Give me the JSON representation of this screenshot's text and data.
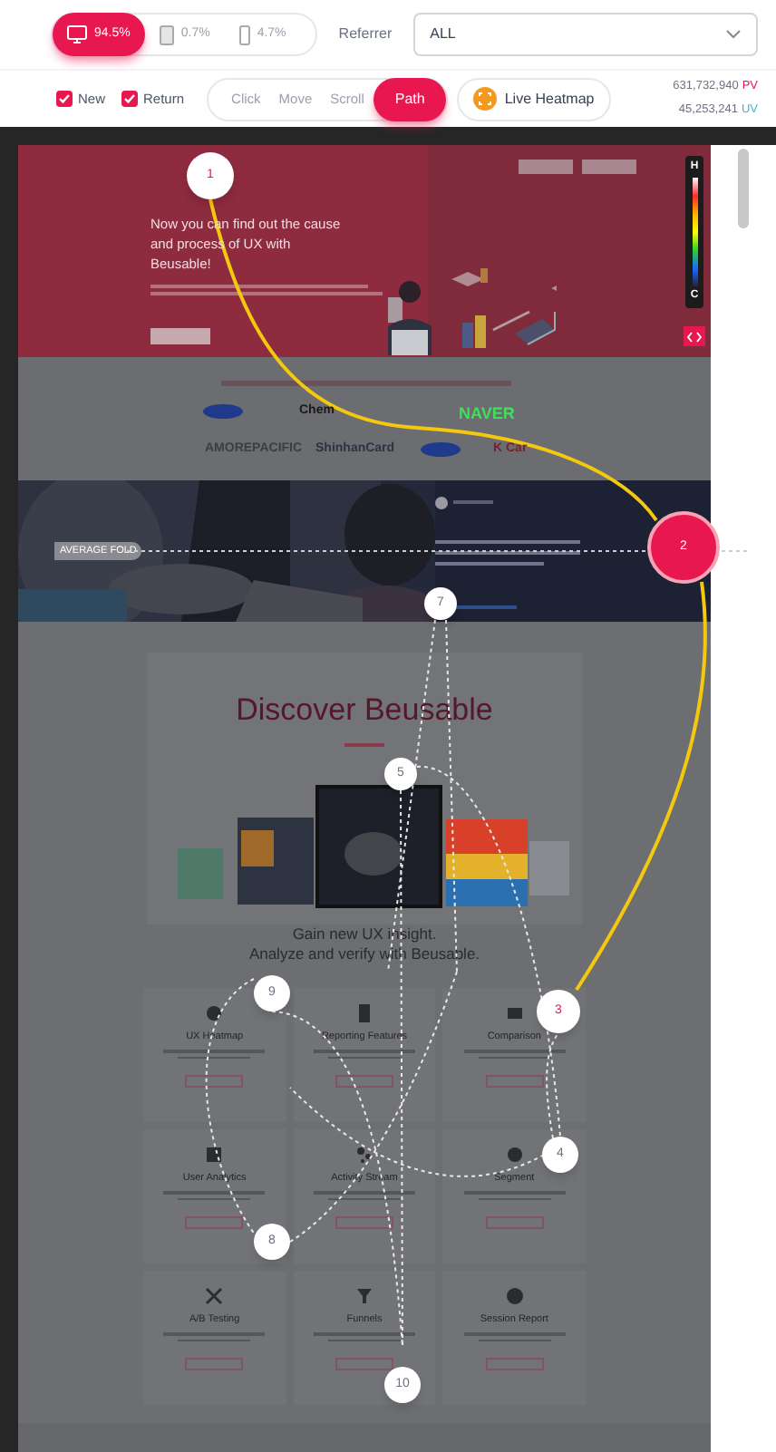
{
  "device_tabs": [
    {
      "label": "94.5%",
      "kind": "desktop",
      "selected": true
    },
    {
      "label": "0.7%",
      "kind": "tablet",
      "selected": false
    },
    {
      "label": "4.7%",
      "kind": "mobile",
      "selected": false
    }
  ],
  "referrer": {
    "label": "Referrer",
    "value": "ALL"
  },
  "filters": [
    {
      "label": "New",
      "checked": true
    },
    {
      "label": "Return",
      "checked": true
    }
  ],
  "modes": [
    {
      "label": "Click",
      "selected": false
    },
    {
      "label": "Move",
      "selected": false
    },
    {
      "label": "Scroll",
      "selected": false
    },
    {
      "label": "Path",
      "selected": true
    }
  ],
  "live_button": {
    "label": "Live Heatmap"
  },
  "stats": [
    {
      "value": "631,732,940",
      "unit": "PV",
      "color": "#e8174f"
    },
    {
      "value": "45,253,241",
      "unit": "UV",
      "color": "#3fb6c4"
    }
  ],
  "site": {
    "hero_title": "Now you can find out the cause and process of UX with Beusable!",
    "logos": [
      {
        "label": "Chem",
        "color": "#1a1a1a"
      },
      {
        "label": "NAVER",
        "color": "#3ee05a"
      },
      {
        "label": "AMOREPACIFIC",
        "color": "#3c3d42"
      },
      {
        "label": "ShinhanCard",
        "color": "#2f3240"
      },
      {
        "label": "K Car",
        "color": "#7a1f2a"
      }
    ],
    "discover_title": "Discover Beusable",
    "tagline": [
      "Gain new UX insight.",
      "Analyze and verify with Beusable."
    ],
    "cards": [
      {
        "title": "UX Heatmap"
      },
      {
        "title": "Reporting Features"
      },
      {
        "title": "Comparison"
      },
      {
        "title": "User Analytics"
      },
      {
        "title": "Activity Stream"
      },
      {
        "title": "Segment"
      },
      {
        "title": "A/B Testing"
      },
      {
        "title": "Funnels"
      },
      {
        "title": "Session Report"
      }
    ]
  },
  "heat_scale": {
    "top": "H",
    "bottom": "C"
  },
  "fold_label": "AVERAGE FOLD",
  "path_markers": [
    {
      "label": "1",
      "kind": "primary"
    },
    {
      "label": "2",
      "kind": "highlight"
    },
    {
      "label": "3",
      "kind": "primary"
    },
    {
      "label": "4",
      "kind": "secondary"
    },
    {
      "label": "5",
      "kind": "secondary"
    },
    {
      "label": "7",
      "kind": "secondary"
    },
    {
      "label": "8",
      "kind": "secondary"
    },
    {
      "label": "9",
      "kind": "secondary"
    },
    {
      "label": "10",
      "kind": "secondary"
    }
  ]
}
